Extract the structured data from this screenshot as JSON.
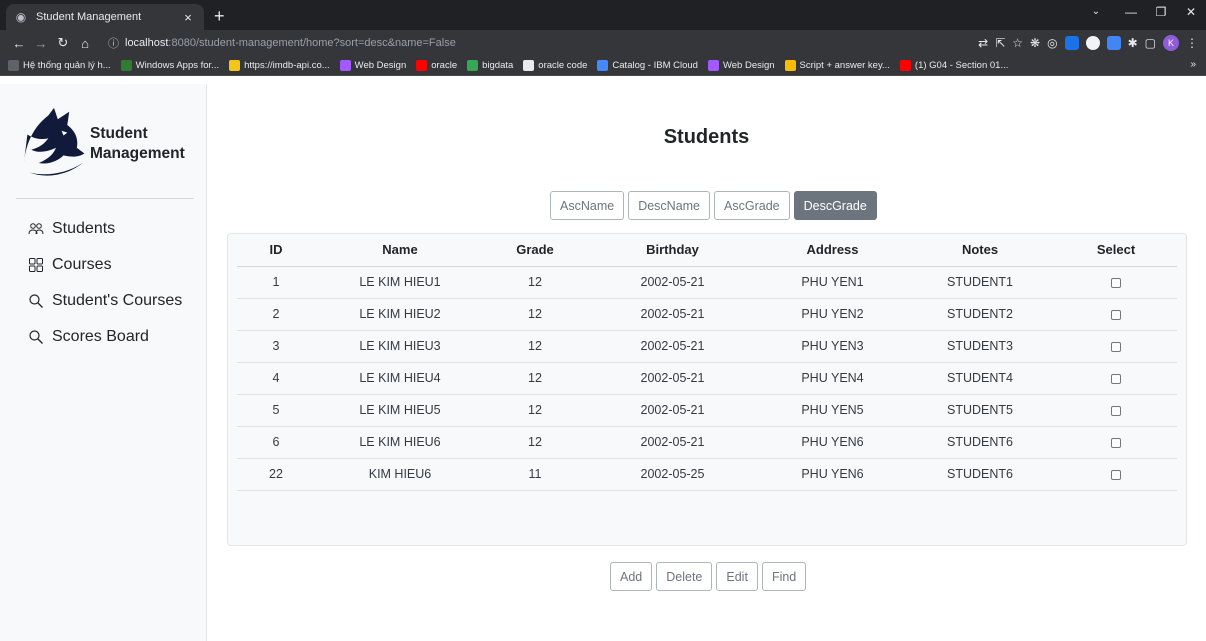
{
  "browser": {
    "tab_title": "Student Management",
    "tab_close": "×",
    "new_tab": "+",
    "url_host": "localhost",
    "url_rest": ":8080/student-management/home?sort=desc&name=False",
    "avatar_letter": "K",
    "bookmarks": [
      {
        "label": "Hệ thống quản lý h...",
        "color": "#5f6368"
      },
      {
        "label": "Windows Apps for...",
        "color": "#2e7d32"
      },
      {
        "label": "https://imdb-api.co...",
        "color": "#f5c518"
      },
      {
        "label": "Web Design",
        "color": "#a259ff"
      },
      {
        "label": "oracle",
        "color": "#ff0000"
      },
      {
        "label": "bigdata",
        "color": "#34a853"
      },
      {
        "label": "oracle code",
        "color": "#e8eaed"
      },
      {
        "label": "Catalog - IBM Cloud",
        "color": "#4589ff"
      },
      {
        "label": "Web Design",
        "color": "#a259ff"
      },
      {
        "label": "Script + answer key...",
        "color": "#fbbc04"
      },
      {
        "label": "(1) G04 - Section 01...",
        "color": "#ff0000"
      }
    ],
    "bookmarks_more": "»"
  },
  "sidebar": {
    "brand_line1": "Student",
    "brand_line2": "Management",
    "items": [
      {
        "label": "Students",
        "icon": "people-icon"
      },
      {
        "label": "Courses",
        "icon": "grid-icon"
      },
      {
        "label": "Student's Courses",
        "icon": "search-icon"
      },
      {
        "label": "Scores Board",
        "icon": "search-icon"
      }
    ]
  },
  "main": {
    "title": "Students",
    "sort_buttons": [
      "AscName",
      "DescName",
      "AscGrade",
      "DescGrade"
    ],
    "active_sort": "DescGrade",
    "columns": [
      "ID",
      "Name",
      "Grade",
      "Birthday",
      "Address",
      "Notes",
      "Select"
    ],
    "rows": [
      {
        "id": "1",
        "name": "LE KIM HIEU1",
        "grade": "12",
        "birthday": "2002-05-21",
        "address": "PHU YEN1",
        "notes": "STUDENT1"
      },
      {
        "id": "2",
        "name": "LE KIM HIEU2",
        "grade": "12",
        "birthday": "2002-05-21",
        "address": "PHU YEN2",
        "notes": "STUDENT2"
      },
      {
        "id": "3",
        "name": "LE KIM HIEU3",
        "grade": "12",
        "birthday": "2002-05-21",
        "address": "PHU YEN3",
        "notes": "STUDENT3"
      },
      {
        "id": "4",
        "name": "LE KIM HIEU4",
        "grade": "12",
        "birthday": "2002-05-21",
        "address": "PHU YEN4",
        "notes": "STUDENT4"
      },
      {
        "id": "5",
        "name": "LE KIM HIEU5",
        "grade": "12",
        "birthday": "2002-05-21",
        "address": "PHU YEN5",
        "notes": "STUDENT5"
      },
      {
        "id": "6",
        "name": "LE KIM HIEU6",
        "grade": "12",
        "birthday": "2002-05-21",
        "address": "PHU YEN6",
        "notes": "STUDENT6"
      },
      {
        "id": "22",
        "name": "KIM HIEU6",
        "grade": "11",
        "birthday": "2002-05-25",
        "address": "PHU YEN6",
        "notes": "STUDENT6"
      }
    ],
    "action_buttons": [
      "Add",
      "Delete",
      "Edit",
      "Find"
    ]
  }
}
